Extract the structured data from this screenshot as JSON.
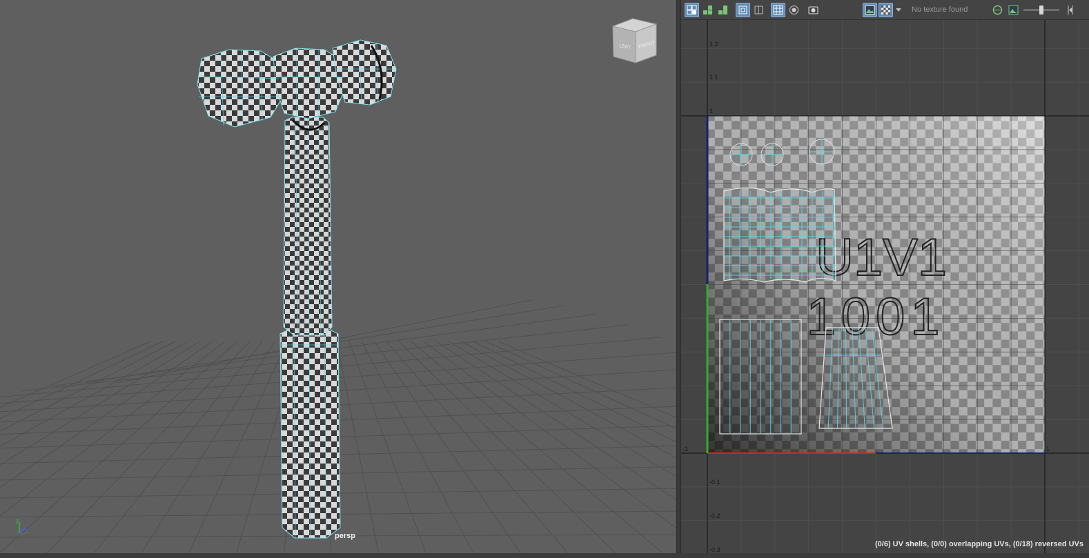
{
  "viewport": {
    "camera_label": "persp",
    "viewcube": {
      "left_face": "LEFT",
      "front_face": "FRONT"
    },
    "axis": {
      "y": "y",
      "z": "z",
      "x": "x"
    }
  },
  "uv_editor": {
    "toolbar": {
      "texture_label": "No texture found",
      "icons": [
        "uv-shell-icon",
        "uv-shell-alt-icon",
        "uv-shell-grow-icon",
        "wireframe-icon",
        "shaded-icon",
        "grid-icon",
        "pin-icon",
        "snapshot-icon",
        "image-display-icon",
        "checker-icon",
        "dropdown-icon",
        "texture-filter-icon",
        "image-icon",
        "exposure-slider-icon",
        "gamma-icon"
      ]
    },
    "tile": {
      "line1": "U1V1",
      "line2": "1001"
    },
    "axis_labels": {
      "v_ticks": [
        "1.2",
        "1.1",
        "1",
        "-0.1",
        "-0.2",
        "-0.3"
      ],
      "u_left": "-1",
      "u_right": "1"
    },
    "status": "(0/6) UV shells, (0/0) overlapping UVs, (0/18) reversed UVs"
  },
  "colors": {
    "viewport_bg": "#5f5f5f",
    "uv_bg": "#444444",
    "wire": "#58d6e8",
    "u_axis": "#e02020",
    "v_axis": "#2fae2f",
    "tile_border": "#1a1f6e",
    "accent": "#5f8ab5"
  }
}
